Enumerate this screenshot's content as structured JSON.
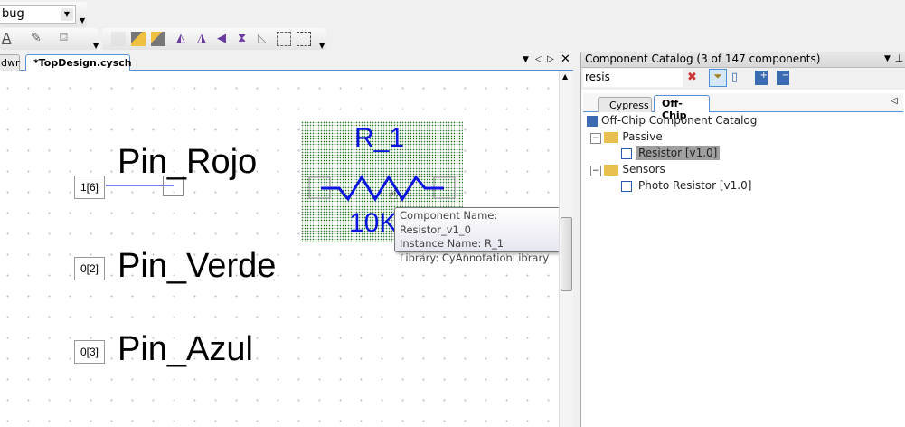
{
  "toolbar": {
    "config_combo_value": "bug"
  },
  "document_tabs": [
    {
      "label": "dwr"
    },
    {
      "label": "*TopDesign.cysch"
    }
  ],
  "schematic": {
    "pins": [
      {
        "port": "1[6]",
        "name": "Pin_Rojo"
      },
      {
        "port": "0[2]",
        "name": "Pin_Verde"
      },
      {
        "port": "0[3]",
        "name": "Pin_Azul"
      }
    ],
    "component": {
      "instance": "R_1",
      "value": "10K"
    },
    "tooltip": {
      "line1": "Component Name: Resistor_v1_0",
      "line2": "Instance Name: R_1",
      "line3": "Library: CyAnnotationLibrary"
    }
  },
  "catalog": {
    "title": "Component Catalog (3 of 147 components)",
    "search_value": "resis",
    "tabs": [
      {
        "label": "Cypress"
      },
      {
        "label": "Off-Chip"
      }
    ],
    "tree": {
      "root": "Off-Chip Component Catalog",
      "groups": [
        {
          "label": "Passive",
          "items": [
            "Resistor [v1.0]"
          ]
        },
        {
          "label": "Sensors",
          "items": [
            "Photo Resistor [v1.0]"
          ]
        }
      ]
    }
  },
  "colors": {
    "accent": "#5a8fd6",
    "component_blue": "#0a14e0",
    "selection": "#a0a0a0"
  }
}
